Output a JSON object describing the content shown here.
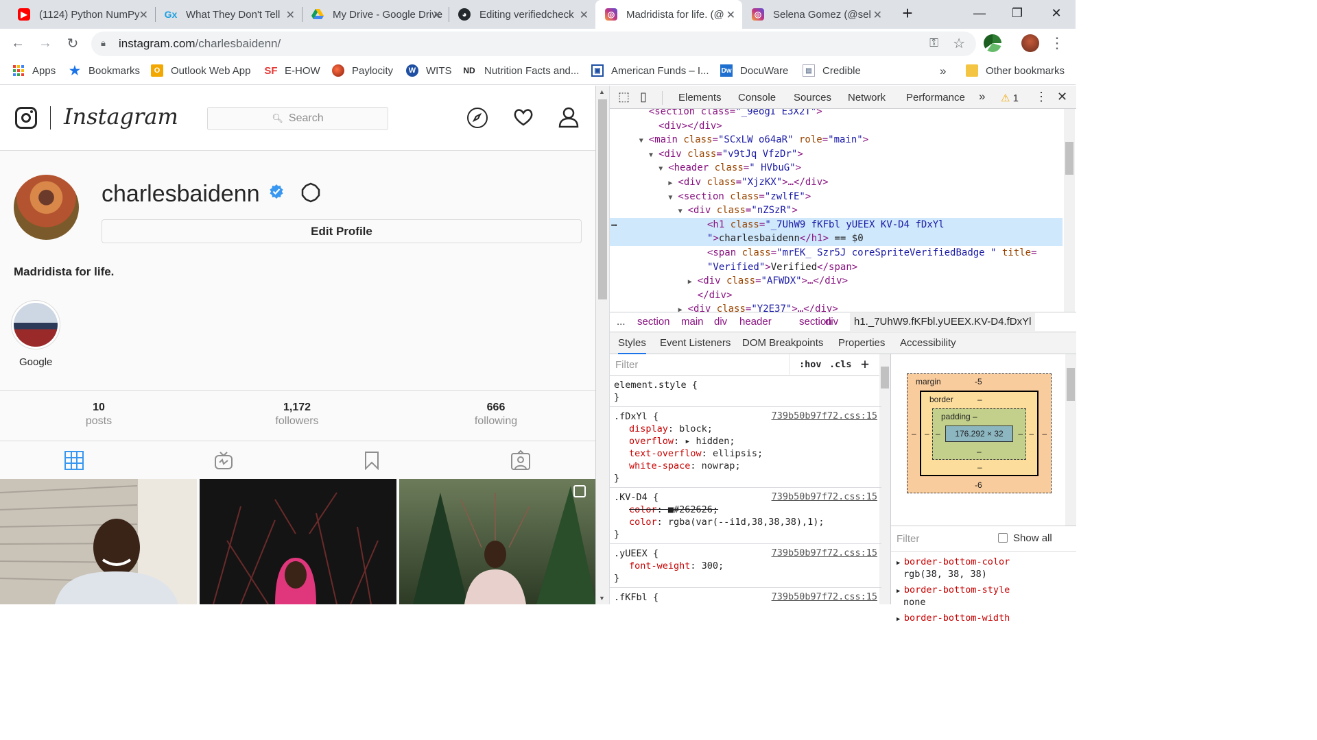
{
  "browser": {
    "tabs": [
      {
        "title": "(1124) Python NumPy",
        "icon": "youtube-icon",
        "color": "#ff0000"
      },
      {
        "title": "What They Don't Tell",
        "icon": "gx-icon",
        "color": "#1ba0e2"
      },
      {
        "title": "My Drive - Google Drive",
        "icon": "google-drive-icon",
        "color": "#0f9d58"
      },
      {
        "title": "Editing verifiedcheck",
        "icon": "github-icon",
        "color": "#24292e"
      },
      {
        "title": "Madridista for life. (@",
        "icon": "instagram-icon",
        "color": "#c13584"
      },
      {
        "title": "Selena Gomez (@sel",
        "icon": "instagram-icon",
        "color": "#c13584"
      }
    ],
    "url_host": "instagram.com",
    "url_path": "/charlesbaidenn/",
    "bookmarks": [
      {
        "label": "Apps",
        "icon": "apps-grid-icon"
      },
      {
        "label": "Bookmarks",
        "icon": "star-icon"
      },
      {
        "label": "Outlook Web App",
        "icon": "outlook-icon"
      },
      {
        "label": "E-HOW",
        "icon": "sf-icon"
      },
      {
        "label": "Paylocity",
        "icon": "paylocity-icon"
      },
      {
        "label": "WITS",
        "icon": "wits-icon"
      },
      {
        "label": "Nutrition Facts and...",
        "icon": "nd-icon"
      },
      {
        "label": "American Funds – I...",
        "icon": "american-funds-icon"
      },
      {
        "label": "DocuWare",
        "icon": "docuware-icon"
      },
      {
        "label": "Credible",
        "icon": "credible-icon"
      }
    ],
    "bookmarks_more": "»",
    "other_bookmarks": "Other bookmarks"
  },
  "instagram": {
    "wordmark": "Instagram",
    "search_placeholder": "Search",
    "username": "charlesbaidenn",
    "edit_profile": "Edit Profile",
    "bio": "Madridista for life.",
    "highlight_label": "Google",
    "stats": [
      {
        "number": "10",
        "label": "posts"
      },
      {
        "number": "1,172",
        "label": "followers"
      },
      {
        "number": "666",
        "label": "following"
      }
    ]
  },
  "devtools": {
    "tabs": [
      "Elements",
      "Console",
      "Sources",
      "Network",
      "Performance"
    ],
    "more": "»",
    "warning_count": "1",
    "dom_lines": [
      {
        "indent": 4,
        "parts": [
          [
            "tg",
            "<section class="
          ],
          [
            "av",
            "\"_9eogI E3X2T\""
          ],
          [
            "tg",
            ">"
          ]
        ]
      },
      {
        "indent": 5,
        "parts": [
          [
            "tg",
            "<div></div>"
          ]
        ]
      },
      {
        "indent": 4,
        "arrow": "▼",
        "parts": [
          [
            "tg",
            "<main "
          ],
          [
            "at",
            "class"
          ],
          [
            "tg",
            "="
          ],
          [
            "av",
            "\"SCxLW  o64aR\""
          ],
          [
            "tg",
            " "
          ],
          [
            "at",
            "role"
          ],
          [
            "tg",
            "="
          ],
          [
            "av",
            "\"main\""
          ],
          [
            "tg",
            ">"
          ]
        ]
      },
      {
        "indent": 5,
        "arrow": "▼",
        "parts": [
          [
            "tg",
            "<div "
          ],
          [
            "at",
            "class"
          ],
          [
            "tg",
            "="
          ],
          [
            "av",
            "\"v9tJq VfzDr\""
          ],
          [
            "tg",
            ">"
          ]
        ]
      },
      {
        "indent": 6,
        "arrow": "▼",
        "parts": [
          [
            "tg",
            "<header "
          ],
          [
            "at",
            "class"
          ],
          [
            "tg",
            "="
          ],
          [
            "av",
            "\" HVbuG\""
          ],
          [
            "tg",
            ">"
          ]
        ]
      },
      {
        "indent": 7,
        "arrow": "▶",
        "parts": [
          [
            "tg",
            "<div "
          ],
          [
            "at",
            "class"
          ],
          [
            "tg",
            "="
          ],
          [
            "av",
            "\"XjzKX\""
          ],
          [
            "tg",
            ">…</div>"
          ]
        ]
      },
      {
        "indent": 7,
        "arrow": "▼",
        "parts": [
          [
            "tg",
            "<section "
          ],
          [
            "at",
            "class"
          ],
          [
            "tg",
            "="
          ],
          [
            "av",
            "\"zwlfE\""
          ],
          [
            "tg",
            ">"
          ]
        ]
      },
      {
        "indent": 8,
        "arrow": "▼",
        "parts": [
          [
            "tg",
            "<div "
          ],
          [
            "at",
            "class"
          ],
          [
            "tg",
            "="
          ],
          [
            "av",
            "\"nZSzR\""
          ],
          [
            "tg",
            ">"
          ]
        ]
      },
      {
        "indent": 10,
        "selected": true,
        "parts": [
          [
            "tg",
            "<h1 "
          ],
          [
            "at",
            "class"
          ],
          [
            "tg",
            "="
          ],
          [
            "av",
            "\"_7UhW9       fKFbl yUEEX   KV-D4          fDxYl"
          ]
        ]
      },
      {
        "indent": 10,
        "selected": true,
        "parts": [
          [
            "av",
            "\""
          ],
          [
            "tg",
            ">"
          ],
          [
            "tx",
            "charlesbaidenn"
          ],
          [
            "tg",
            "</h1>"
          ],
          [
            "tx",
            " == $0"
          ]
        ]
      },
      {
        "indent": 10,
        "parts": [
          [
            "tg",
            "<span "
          ],
          [
            "at",
            "class"
          ],
          [
            "tg",
            "="
          ],
          [
            "av",
            "\"mrEK_ Szr5J coreSpriteVerifiedBadge \""
          ],
          [
            "tg",
            " "
          ],
          [
            "at",
            "title"
          ],
          [
            "tg",
            "="
          ]
        ]
      },
      {
        "indent": 10,
        "parts": [
          [
            "av",
            "\"Verified\""
          ],
          [
            "tg",
            ">"
          ],
          [
            "tx",
            "Verified"
          ],
          [
            "tg",
            "</span>"
          ]
        ]
      },
      {
        "indent": 9,
        "arrow": "▶",
        "parts": [
          [
            "tg",
            "<div "
          ],
          [
            "at",
            "class"
          ],
          [
            "tg",
            "="
          ],
          [
            "av",
            "\"AFWDX\""
          ],
          [
            "tg",
            ">…</div>"
          ]
        ]
      },
      {
        "indent": 9,
        "parts": [
          [
            "tg",
            "</div>"
          ]
        ]
      },
      {
        "indent": 8,
        "arrow": "▶",
        "parts": [
          [
            "tg",
            "<div "
          ],
          [
            "at",
            "class"
          ],
          [
            "tg",
            "="
          ],
          [
            "av",
            "\"Y2E37\""
          ],
          [
            "tg",
            ">…</div>"
          ]
        ]
      }
    ],
    "breadcrumbs": [
      "...",
      "section",
      "main",
      "div",
      "header",
      "section",
      "div",
      "h1._7UhW9.fKFbl.yUEEX.KV-D4.fDxYl"
    ],
    "subtabs": [
      "Styles",
      "Event Listeners",
      "DOM Breakpoints",
      "Properties",
      "Accessibility"
    ],
    "styles_filter": "Filter",
    "hov": ":hov",
    "cls": ".cls",
    "plus": "+",
    "rules": [
      {
        "selector": "element.style {",
        "source": "",
        "decls": [],
        "close": "}"
      },
      {
        "selector": ".fDxYl {",
        "source": "739b50b97f72.css:15",
        "decls": [
          [
            "display",
            "block;"
          ],
          [
            "overflow",
            "▸ hidden;"
          ],
          [
            "text-overflow",
            "ellipsis;"
          ],
          [
            "white-space",
            "nowrap;"
          ]
        ],
        "close": "}"
      },
      {
        "selector": ".KV-D4 {",
        "source": "739b50b97f72.css:15",
        "decls": [
          [
            "color",
            "■#262626;",
            "strike"
          ],
          [
            "color",
            "rgba(var(--i1d,38,38,38),1);"
          ]
        ],
        "close": "}"
      },
      {
        "selector": ".yUEEX {",
        "source": "739b50b97f72.css:15",
        "decls": [
          [
            "font-weight",
            "300;"
          ]
        ],
        "close": "}"
      },
      {
        "selector": ".fKFbl {",
        "source": "739b50b97f72.css:15",
        "decls": [],
        "close": ""
      }
    ],
    "boxmodel": {
      "margin_label": "margin",
      "margin_top": "-5",
      "margin_bottom": "-6",
      "margin_side": "–",
      "border_label": "border",
      "border_val": "–",
      "padding_label": "padding –",
      "padding_val": "–",
      "content": "176.292 × 32"
    },
    "computed_filter": "Filter",
    "show_all": "Show all",
    "computed": [
      {
        "prop": "border-bottom-color",
        "val": "rgb(38, 38, 38)"
      },
      {
        "prop": "border-bottom-style",
        "val": "none"
      },
      {
        "prop": "border-bottom-width",
        "val": ""
      }
    ]
  }
}
